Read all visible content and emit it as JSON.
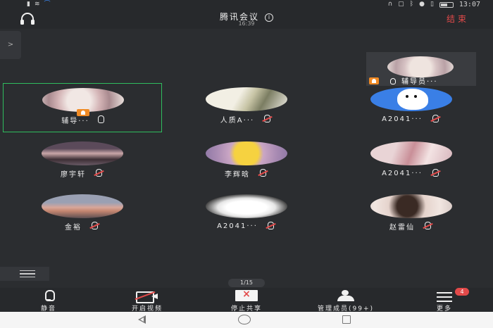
{
  "status_bar": {
    "time": "13:07",
    "icons": [
      "notification-icon",
      "wifi-icon",
      "headset-icon",
      "nfc-icon",
      "bluetooth-icon",
      "mic-icon",
      "vibrate-icon",
      "battery-icon"
    ]
  },
  "header": {
    "title": "腾讯会议",
    "duration": "16:39",
    "end_label": "结束"
  },
  "side_handle": {
    "glyph": ">"
  },
  "self_view": {
    "name": "辅导员···"
  },
  "participants": [
    {
      "name": "辅导···",
      "mic": "on",
      "host": true,
      "active": true
    },
    {
      "name": "人质A···",
      "mic": "muted"
    },
    {
      "name": "A2041···",
      "mic": "muted"
    },
    {
      "name": "廖宇轩",
      "mic": "muted"
    },
    {
      "name": "李辉晗",
      "mic": "muted"
    },
    {
      "name": "A2041···",
      "mic": "muted"
    },
    {
      "name": "金裕",
      "mic": "muted"
    },
    {
      "name": "A2041···",
      "mic": "muted"
    },
    {
      "name": "赵雷仙",
      "mic": "muted"
    }
  ],
  "pager": {
    "text": "1/15"
  },
  "toolbar": {
    "mute_label": "静音",
    "video_label": "开启视频",
    "share_label": "停止共享",
    "members_label": "管理成员(99+)",
    "more_label": "更多",
    "more_badge": "4"
  }
}
